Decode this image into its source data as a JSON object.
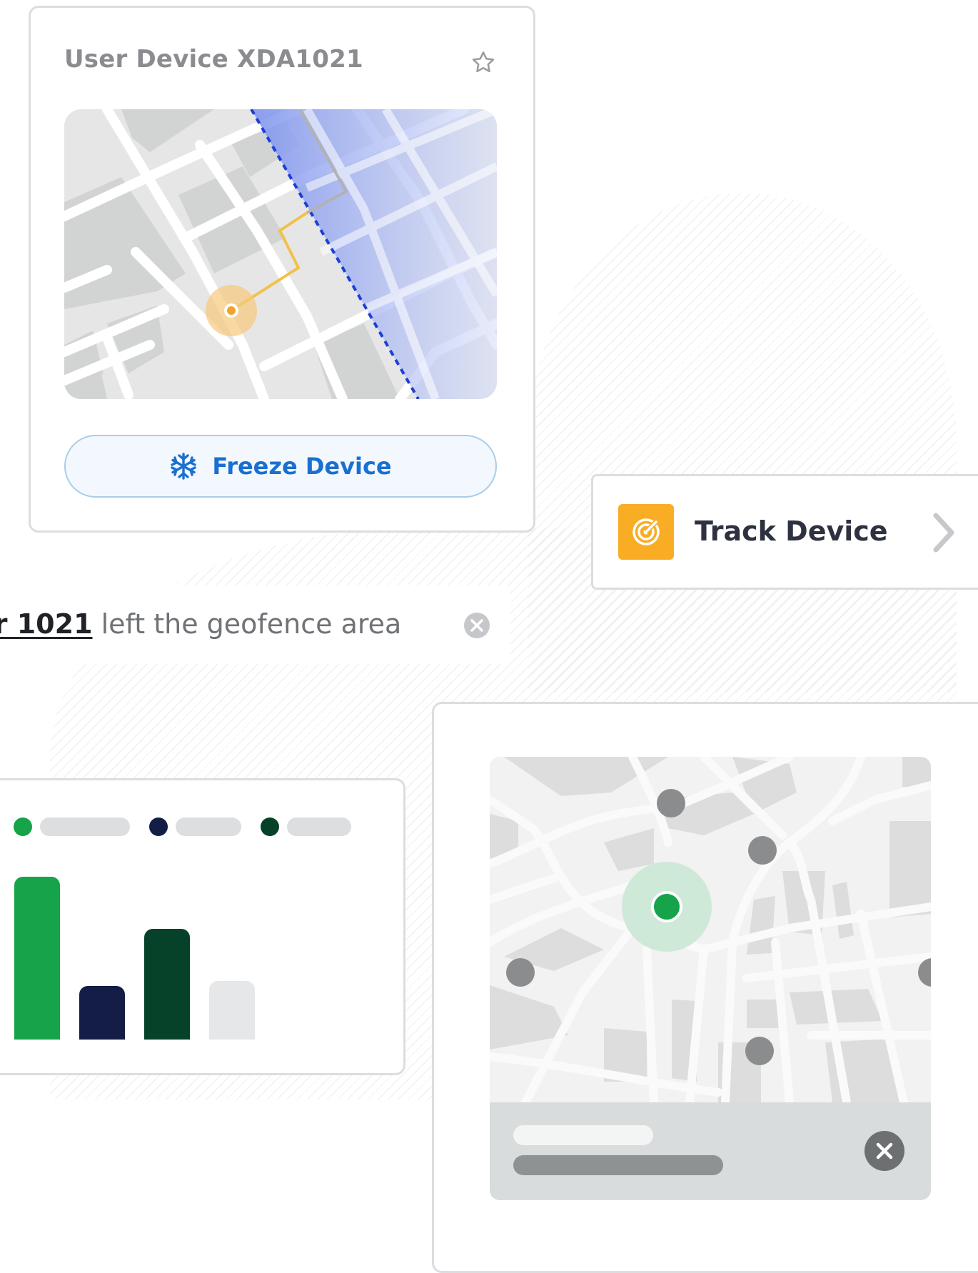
{
  "device_card": {
    "title": "User Device XDA1021",
    "favorite_icon": "star-outline-icon",
    "freeze_button": {
      "label": "Freeze Device",
      "icon": "snowflake-icon"
    }
  },
  "track_card": {
    "label": "Track Device",
    "icon": "target-icon",
    "chevron_icon": "chevron-right-icon",
    "accent_color": "#f9ad24"
  },
  "notification": {
    "user_link": "er 1021",
    "message": " left the geofence area",
    "close_icon": "close-circle-icon"
  },
  "chart_card": {
    "chart_data": {
      "type": "bar",
      "categories": [
        "",
        "",
        "",
        ""
      ],
      "values": [
        100,
        33,
        68,
        36
      ],
      "colors": [
        "#16a34a",
        "#131d45",
        "#06422a",
        "#e5e7e9"
      ],
      "legend": [
        {
          "color": "#16a34a"
        },
        {
          "color": "#131d45"
        },
        {
          "color": "#06422a"
        }
      ]
    }
  },
  "map_card": {
    "active_marker_color": "#16a34a",
    "marker_color": "#8a8c8d",
    "toast_close_icon": "close-icon"
  },
  "colors": {
    "route_line": "#f2c14b",
    "geofence_border": "#1b3fd8",
    "geofence_fill": "#7f95ee",
    "freeze_blue": "#1a6fd0"
  }
}
